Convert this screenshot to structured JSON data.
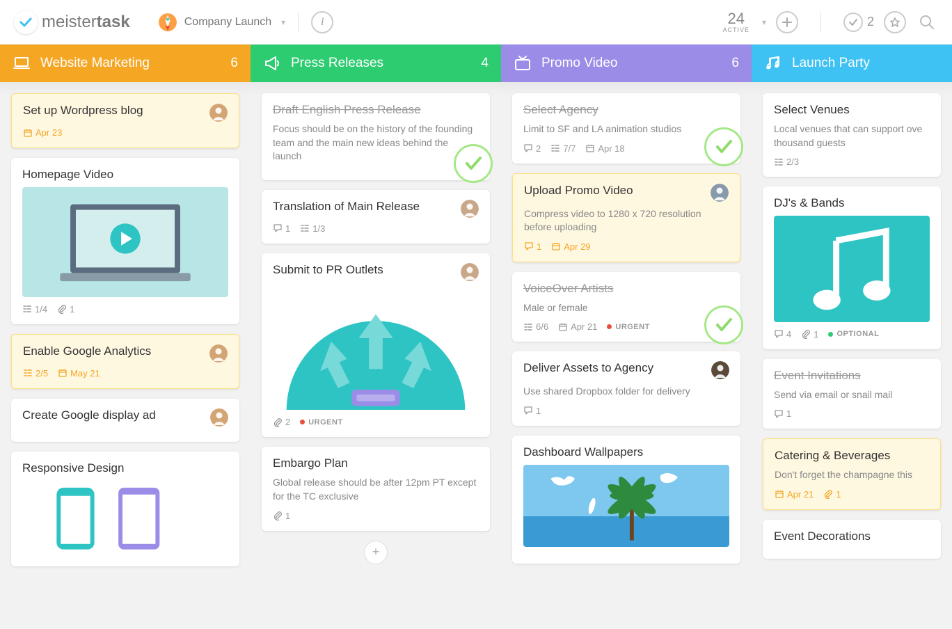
{
  "header": {
    "logo_light": "meister",
    "logo_bold": "task",
    "project": "Company Launch",
    "active_num": "24",
    "active_label": "ACTIVE",
    "check_count": "2"
  },
  "columns": [
    {
      "title": "Website Marketing",
      "count": "6",
      "color": "c-orange",
      "icon": "laptop",
      "cards": [
        {
          "title": "Set up Wordpress blog",
          "due": true,
          "avatar": "#d4a574",
          "meta_date": "Apr 23"
        },
        {
          "title": "Homepage Video",
          "image": "laptop-play",
          "meta_check": "1/4",
          "meta_attach": "1"
        },
        {
          "title": "Enable Google Analytics",
          "due": true,
          "avatar": "#d4a574",
          "meta_check": "2/5",
          "meta_date": "May 21"
        },
        {
          "title": "Create Google display ad",
          "avatar": "#d4a574"
        },
        {
          "title": "Responsive Design",
          "image": "phones"
        }
      ]
    },
    {
      "title": "Press Releases",
      "count": "4",
      "color": "c-green",
      "icon": "megaphone",
      "cards": [
        {
          "title": "Draft English Press Release",
          "done": true,
          "desc": "Focus should be on the history of the founding team and the main new ideas behind the launch",
          "check_badge": true
        },
        {
          "title": "Translation of Main Release",
          "avatar": "#c9a88a",
          "meta_comment": "1",
          "meta_check": "1/3"
        },
        {
          "title": "Submit to PR Outlets",
          "avatar": "#c9a88a",
          "image": "arrows-up",
          "meta_attach": "2",
          "tag": "URGENT",
          "tag_color": "#E74C3C"
        },
        {
          "title": "Embargo Plan",
          "desc": "Global release should be after 12pm PT except for the TC exclusive",
          "meta_attach": "1"
        }
      ],
      "show_add": true
    },
    {
      "title": "Promo Video",
      "count": "6",
      "color": "c-purple",
      "icon": "tv",
      "cards": [
        {
          "title": "Select Agency",
          "done": true,
          "desc": "Limit to SF and LA animation studios",
          "meta_comment": "2",
          "meta_check": "7/7",
          "meta_date_gray": "Apr 18",
          "check_badge": true
        },
        {
          "title": "Upload Promo Video",
          "due": true,
          "avatar": "#8899aa",
          "desc": "Compress video to 1280 x 720 resolution before uploading",
          "meta_comment": "1",
          "meta_date": "Apr 29"
        },
        {
          "title": "VoiceOver Artists",
          "done": true,
          "desc": "Male or female",
          "meta_check": "6/6",
          "meta_date_gray": "Apr 21",
          "tag": "URGENT",
          "tag_color": "#E74C3C",
          "check_badge": true
        },
        {
          "title": "Deliver Assets to Agency",
          "avatar": "#5a4a3a",
          "desc": "Use shared Dropbox folder for delivery",
          "meta_comment": "1"
        },
        {
          "title": "Dashboard Wallpapers",
          "image": "beach"
        }
      ]
    },
    {
      "title": "Launch Party",
      "count": "",
      "color": "c-blue",
      "icon": "music",
      "cards": [
        {
          "title": "Select Venues",
          "desc": "Local venues that can support ove thousand guests",
          "meta_check": "2/3"
        },
        {
          "title": "DJ's & Bands",
          "image": "music-note",
          "meta_comment": "4",
          "meta_attach": "1",
          "tag": "OPTIONAL",
          "tag_color": "#2ECC71"
        },
        {
          "title": "Event Invitations",
          "done": true,
          "desc": "Send via email or snail mail",
          "meta_comment": "1"
        },
        {
          "title": "Catering & Beverages",
          "due": true,
          "desc": "Don't forget the champagne this",
          "meta_date": "Apr 21",
          "meta_attach": "1"
        },
        {
          "title": "Event Decorations",
          "faded": true
        }
      ]
    }
  ]
}
